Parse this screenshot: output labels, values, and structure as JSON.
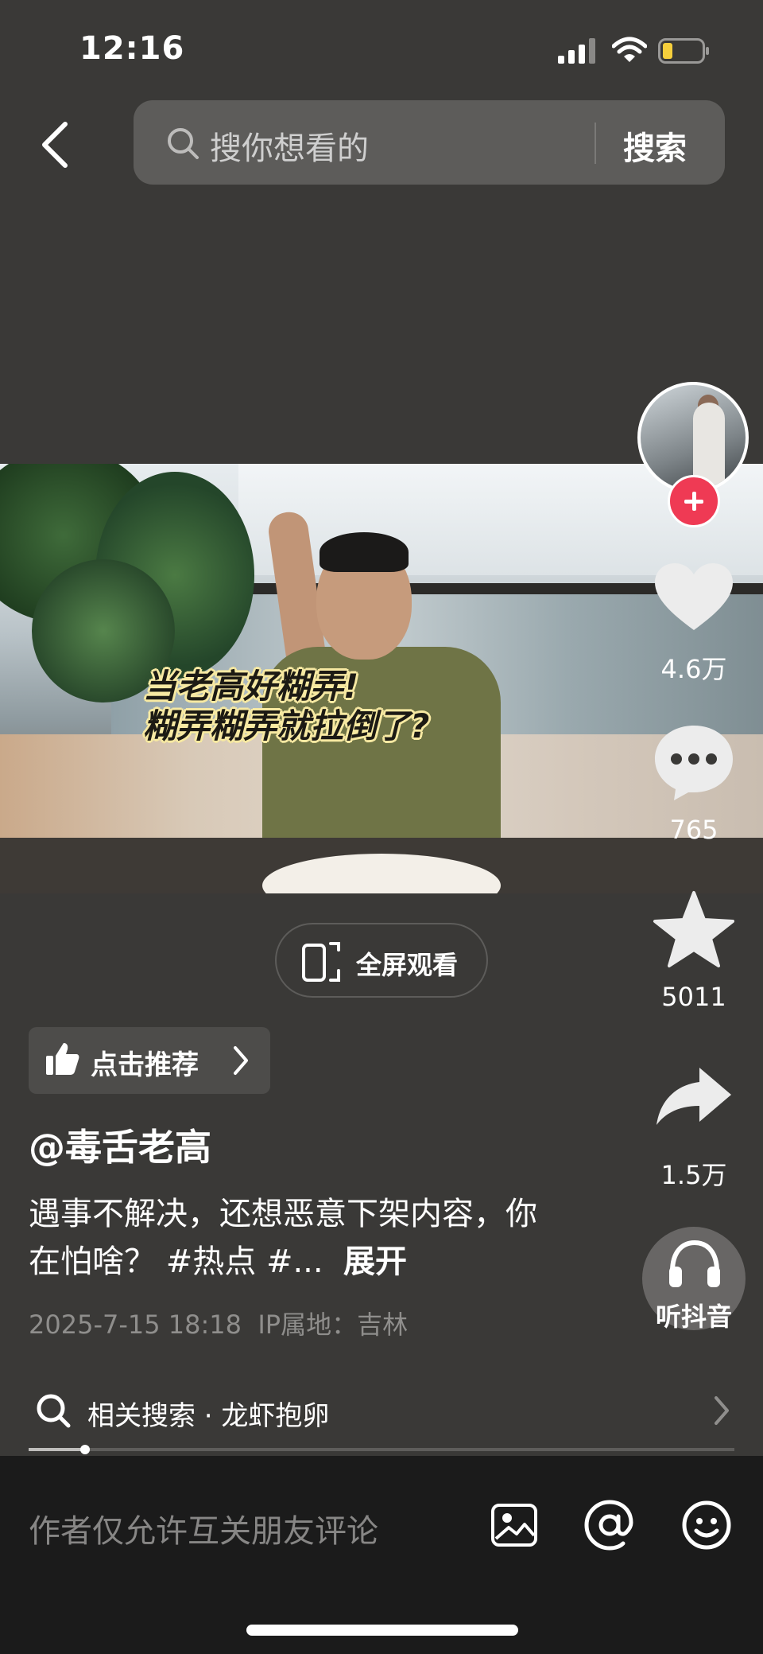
{
  "status_bar": {
    "time": "12:16"
  },
  "search": {
    "placeholder": "搜你想看的",
    "button_label": "搜索"
  },
  "video": {
    "caption_line1": "当老高好糊弄!",
    "caption_line2": "糊弄糊弄就拉倒了?"
  },
  "actions": {
    "likes": "4.6万",
    "comments": "765",
    "favorites": "5011",
    "shares": "1.5万",
    "listen_label": "听抖音"
  },
  "fullscreen": {
    "label": "全屏观看"
  },
  "recommend": {
    "label": "点击推荐"
  },
  "post": {
    "author": "@毒舌老高",
    "description": "遇事不解决，还想恶意下架内容，你在怕啥？ #热点 #...",
    "expand_label": "展开",
    "timestamp": "2025-7-15 18:18",
    "ip_location": "IP属地：吉林"
  },
  "related": {
    "label": "相关搜索 · 龙虾抱卵"
  },
  "playback": {
    "progress": 0.08
  },
  "comment_bar": {
    "hint": "作者仅允许互关朋友评论"
  },
  "colors": {
    "background": "#3a3937",
    "follow_red": "#ef3a54",
    "bottom_bar": "#1b1b1b"
  },
  "icons": [
    "back-icon",
    "search-icon",
    "heart-icon",
    "comment-icon",
    "star-icon",
    "share-icon",
    "headphones-icon",
    "fullscreen-icon",
    "thumb-up-icon",
    "image-icon",
    "at-icon",
    "emoji-icon"
  ]
}
